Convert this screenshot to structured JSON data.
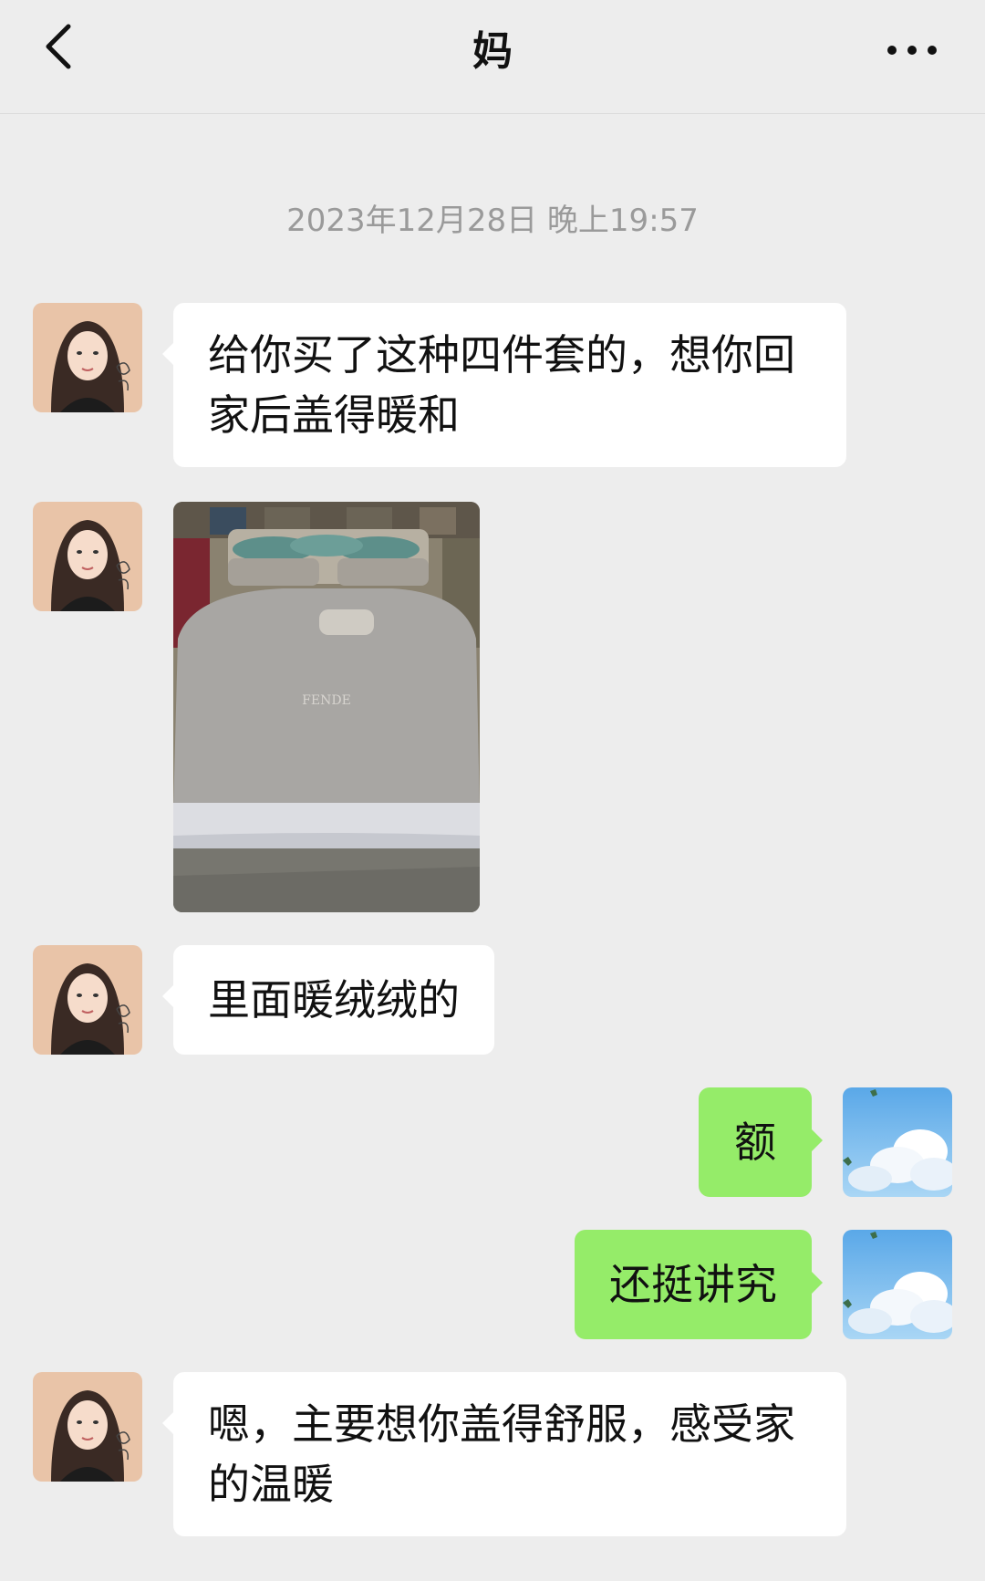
{
  "header": {
    "title": "妈",
    "back_icon": "chevron-left-icon",
    "more_icon": "more-dots-icon"
  },
  "timestamp": "2023年12月28日 晚上19:57",
  "messages": [
    {
      "side": "left",
      "type": "text",
      "text": "给你买了这种四件套的，想你回家后盖得暖和"
    },
    {
      "side": "left",
      "type": "image",
      "text": "FENDE"
    },
    {
      "side": "left",
      "type": "text",
      "text": "里面暖绒绒的"
    },
    {
      "side": "right",
      "type": "text",
      "text": "额"
    },
    {
      "side": "right",
      "type": "text",
      "text": "还挺讲究"
    },
    {
      "side": "left",
      "type": "text",
      "text": "嗯，主要想你盖得舒服，感受家的温暖"
    }
  ],
  "colors": {
    "background": "#ededed",
    "left_bubble": "#ffffff",
    "right_bubble": "#95ec69",
    "timestamp": "#9a9a9a"
  }
}
